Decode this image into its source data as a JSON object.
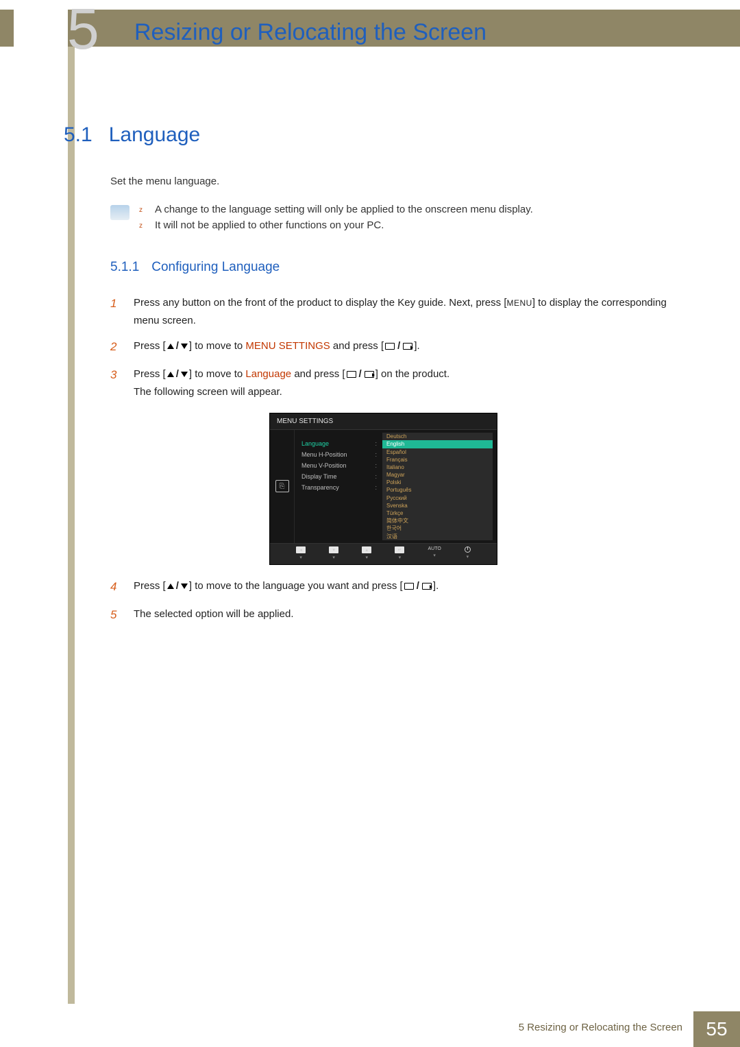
{
  "header": {
    "chapter_number": "5",
    "chapter_title": "Resizing or Relocating the Screen"
  },
  "section": {
    "number": "5.1",
    "title": "Language",
    "intro": "Set the menu language.",
    "notes": [
      "A change to the language setting will only be applied to the onscreen menu display.",
      "It will not be applied to other functions on your PC."
    ]
  },
  "subsection": {
    "number": "5.1.1",
    "title": "Configuring Language"
  },
  "steps": {
    "s1": {
      "num": "1",
      "part1": "Press any button on the front of the product to display the Key guide. Next, press [",
      "menu_btn": "MENU",
      "part2": "] to display the corresponding menu screen."
    },
    "s2": {
      "num": "2",
      "part1": "Press [",
      "part2": "] to move to ",
      "hl": "MENU SETTINGS",
      "part3": " and press [",
      "part4": "]."
    },
    "s3": {
      "num": "3",
      "part1": "Press [",
      "part2": "] to move to ",
      "hl": "Language",
      "part3": " and press [",
      "part4": "] on the product.",
      "line2": "The following screen will appear."
    },
    "s4": {
      "num": "4",
      "part1": "Press [",
      "part2": "] to move to the language you want and press [",
      "part3": "]."
    },
    "s5": {
      "num": "5",
      "text": "The selected option will be applied."
    }
  },
  "osd": {
    "title": "MENU SETTINGS",
    "left_items": [
      {
        "label": "Language",
        "selected": true
      },
      {
        "label": "Menu H-Position",
        "selected": false
      },
      {
        "label": "Menu V-Position",
        "selected": false
      },
      {
        "label": "Display Time",
        "selected": false
      },
      {
        "label": "Transparency",
        "selected": false
      }
    ],
    "languages": [
      {
        "label": "Deutsch",
        "selected": false
      },
      {
        "label": "English",
        "selected": true
      },
      {
        "label": "Español",
        "selected": false
      },
      {
        "label": "Français",
        "selected": false
      },
      {
        "label": "Italiano",
        "selected": false
      },
      {
        "label": "Magyar",
        "selected": false
      },
      {
        "label": "Polski",
        "selected": false
      },
      {
        "label": "Português",
        "selected": false
      },
      {
        "label": "Русский",
        "selected": false
      },
      {
        "label": "Svenska",
        "selected": false
      },
      {
        "label": "Türkçe",
        "selected": false
      },
      {
        "label": "简体中文",
        "selected": false
      },
      {
        "label": "한국어",
        "selected": false
      },
      {
        "label": "汉语",
        "selected": false
      }
    ],
    "footer_auto": "AUTO"
  },
  "footer": {
    "text": "5 Resizing or Relocating the Screen",
    "page": "55"
  }
}
